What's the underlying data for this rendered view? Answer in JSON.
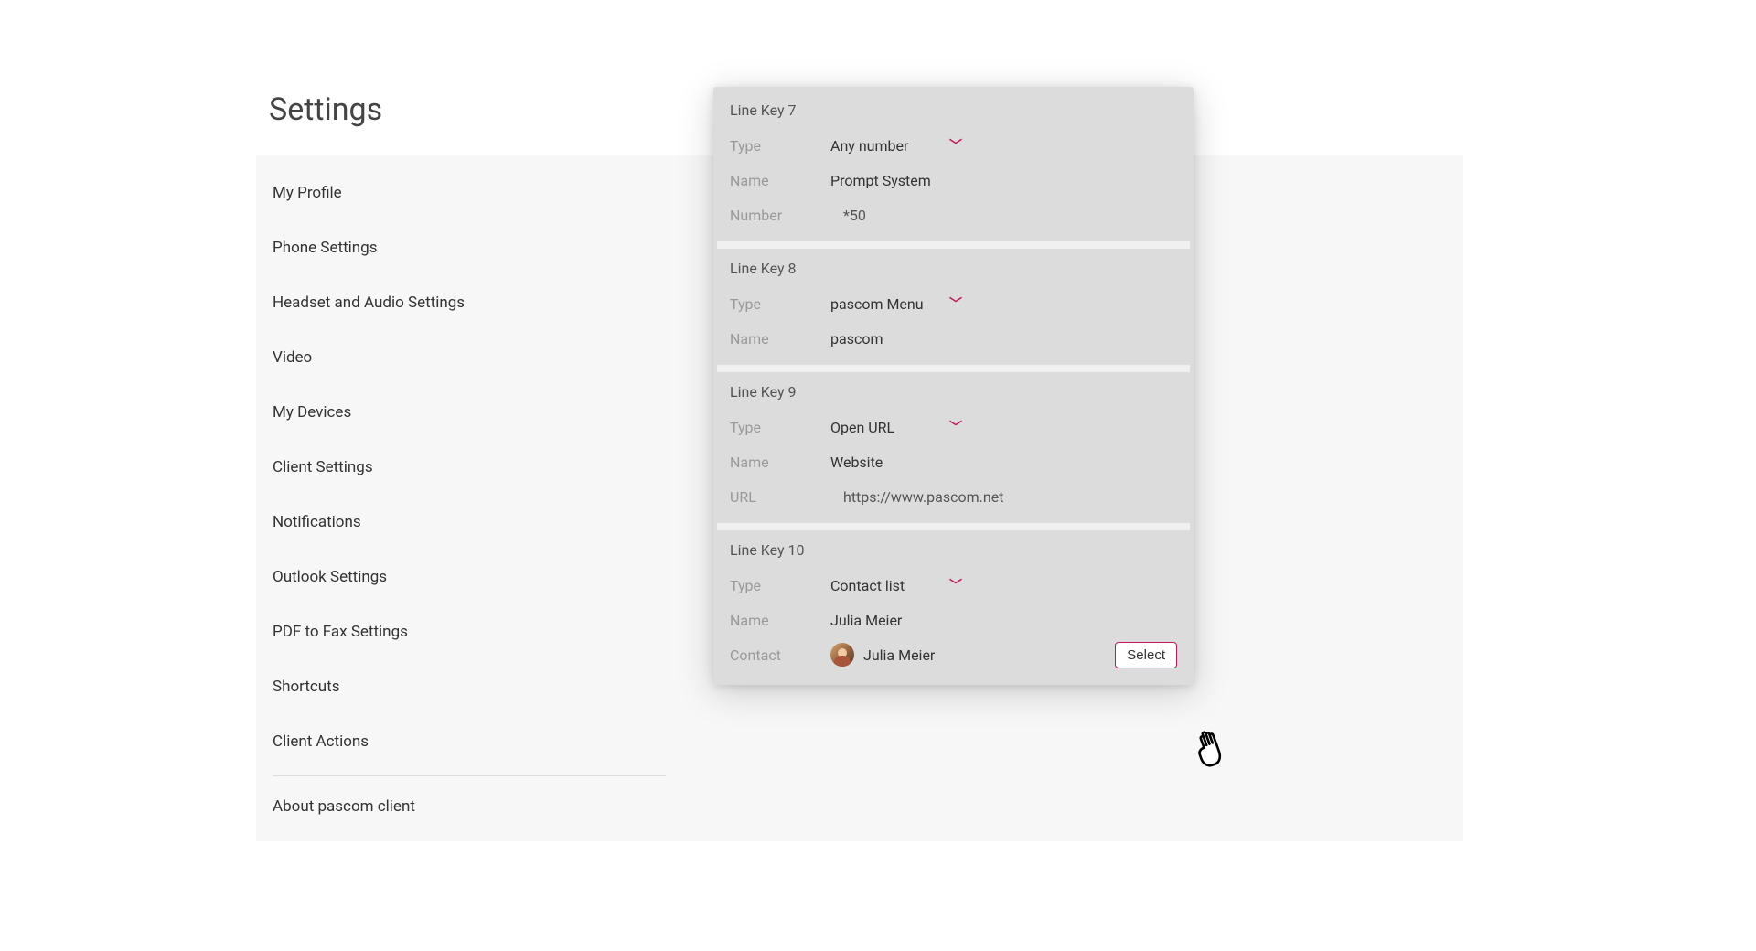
{
  "page": {
    "title": "Settings"
  },
  "sidebar": {
    "items": [
      "My Profile",
      "Phone Settings",
      "Headset and Audio Settings",
      "Video",
      "My Devices",
      "Client Settings",
      "Notifications",
      "Outlook Settings",
      "PDF to Fax Settings",
      "Shortcuts",
      "Client Actions"
    ],
    "about": "About pascom client"
  },
  "labels": {
    "type": "Type",
    "name": "Name",
    "number": "Number",
    "url": "URL",
    "contact": "Contact",
    "select": "Select"
  },
  "cards": [
    {
      "title": "Line Key 7",
      "type": "Any number",
      "name": "Prompt System",
      "number": "*50"
    },
    {
      "title": "Line Key 8",
      "type": "pascom Menu",
      "name": "pascom"
    },
    {
      "title": "Line Key 9",
      "type": "Open URL",
      "name": "Website",
      "url": "https://www.pascom.net"
    },
    {
      "title": "Line Key 10",
      "type": "Contact list",
      "name": "Julia Meier",
      "contact": "Julia Meier"
    }
  ],
  "colors": {
    "accent": "#c2185b"
  }
}
